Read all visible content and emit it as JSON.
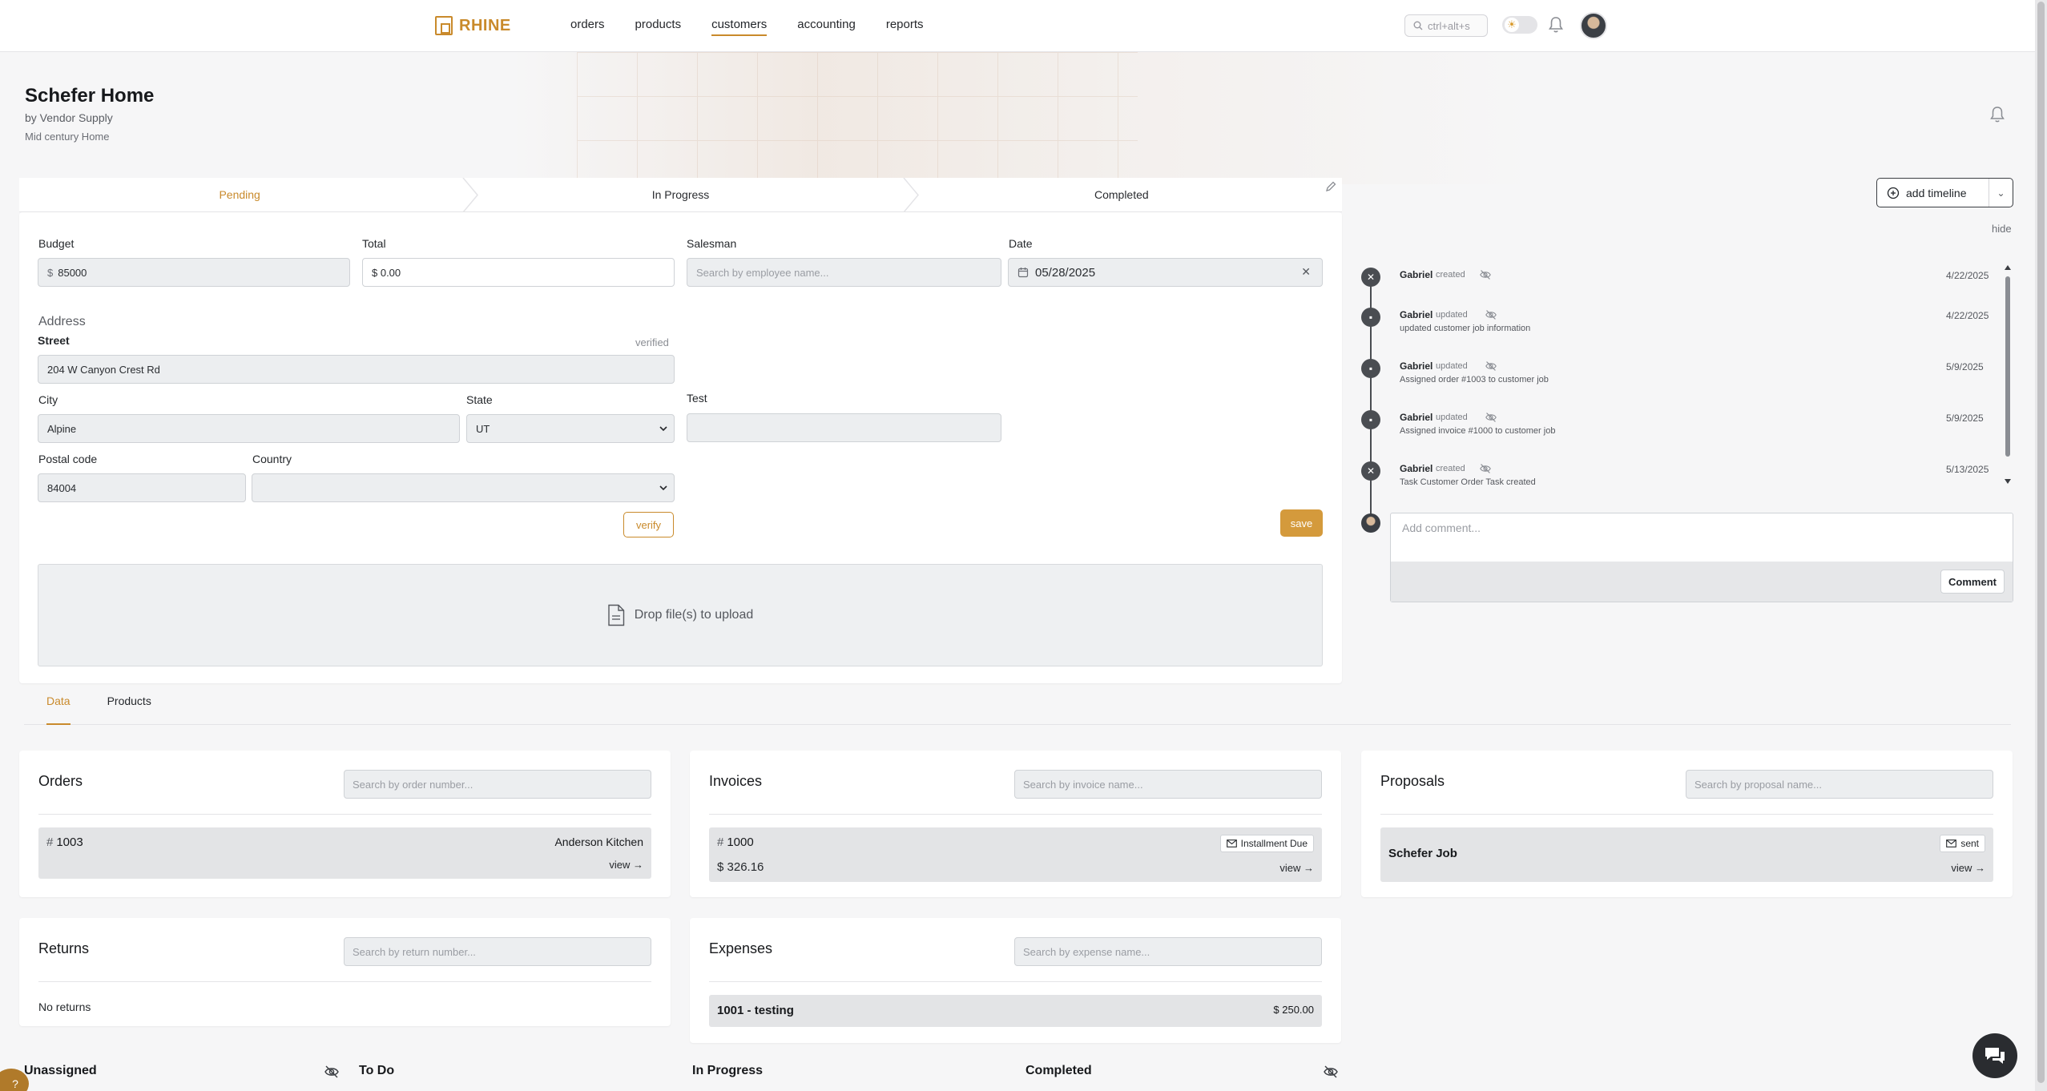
{
  "nav": {
    "brand": "RHINE",
    "items": [
      "orders",
      "products",
      "customers",
      "accounting",
      "reports"
    ],
    "active": "customers",
    "search_shortcut": "ctrl+alt+s"
  },
  "header": {
    "title": "Schefer Home",
    "vendor": "by Vendor Supply",
    "subtitle": "Mid century Home"
  },
  "stepper": {
    "steps": [
      "Pending",
      "In Progress",
      "Completed"
    ],
    "active": "Pending"
  },
  "form": {
    "budget": {
      "label": "Budget",
      "prefix": "$",
      "value": "85000"
    },
    "total": {
      "label": "Total",
      "value": "$ 0.00"
    },
    "salesman": {
      "label": "Salesman",
      "placeholder": "Search by employee name..."
    },
    "date": {
      "label": "Date",
      "value": "05/28/2025"
    },
    "address_title": "Address",
    "street": {
      "label": "Street",
      "value": "204 W Canyon Crest Rd",
      "status": "verified"
    },
    "city": {
      "label": "City",
      "value": "Alpine"
    },
    "state": {
      "label": "State",
      "value": "UT"
    },
    "test": {
      "label": "Test",
      "value": ""
    },
    "postal": {
      "label": "Postal code",
      "value": "84004"
    },
    "country": {
      "label": "Country",
      "value": ""
    },
    "verify_label": "verify",
    "save_label": "save",
    "dropzone_label": "Drop file(s) to upload"
  },
  "timeline": {
    "add_label": "add timeline",
    "hide_label": "hide",
    "events": [
      {
        "user": "Gabriel",
        "action": "created",
        "date": "4/22/2025",
        "desc": "",
        "icon": "wrench-icon"
      },
      {
        "user": "Gabriel",
        "action": "updated",
        "date": "4/22/2025",
        "desc": "updated customer job information",
        "icon": "folder-icon"
      },
      {
        "user": "Gabriel",
        "action": "updated",
        "date": "5/9/2025",
        "desc": "Assigned order #1003 to customer job",
        "icon": "folder-icon"
      },
      {
        "user": "Gabriel",
        "action": "updated",
        "date": "5/9/2025",
        "desc": "Assigned invoice #1000 to customer job",
        "icon": "folder-icon"
      },
      {
        "user": "Gabriel",
        "action": "created",
        "date": "5/13/2025",
        "desc": "Task Customer Order Task created",
        "icon": "wrench-icon"
      }
    ],
    "comment_placeholder": "Add comment...",
    "comment_button": "Comment"
  },
  "tabs": [
    "Data",
    "Products"
  ],
  "active_tab": "Data",
  "orders": {
    "title": "Orders",
    "search_placeholder": "Search by order number...",
    "rows": [
      {
        "number": "1003",
        "customer": "Anderson Kitchen",
        "view": "view →"
      }
    ]
  },
  "invoices": {
    "title": "Invoices",
    "search_placeholder": "Search by invoice name...",
    "rows": [
      {
        "number": "1000",
        "amount": "$ 326.16",
        "status": "Installment Due",
        "view": "view →"
      }
    ]
  },
  "proposals": {
    "title": "Proposals",
    "search_placeholder": "Search by proposal name...",
    "rows": [
      {
        "name": "Schefer Job",
        "status": "sent",
        "view": "view →"
      }
    ]
  },
  "returns": {
    "title": "Returns",
    "search_placeholder": "Search by return number...",
    "empty": "No returns"
  },
  "expenses": {
    "title": "Expenses",
    "search_placeholder": "Search by expense name...",
    "rows": [
      {
        "name": "1001 - testing",
        "amount": "$ 250.00"
      }
    ]
  },
  "kanban": {
    "columns": [
      "Unassigned",
      "To Do",
      "In Progress",
      "Completed"
    ]
  },
  "colors": {
    "accent": "#c98a2b",
    "timeline": "#4a4d52"
  }
}
